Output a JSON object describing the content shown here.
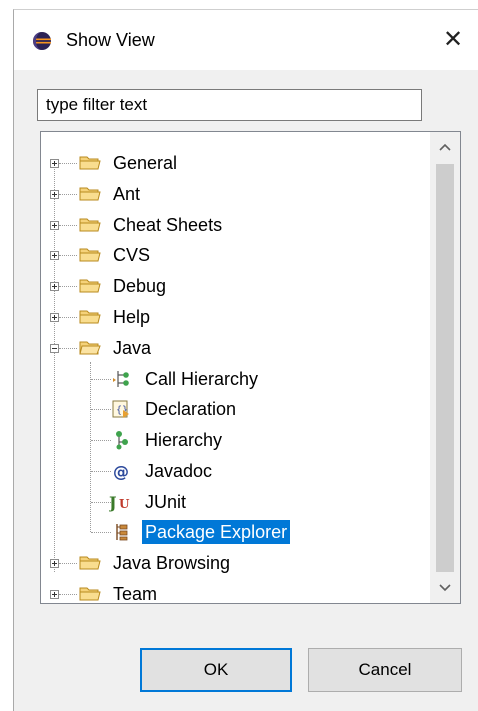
{
  "dialog": {
    "title": "Show View",
    "close_glyph": "✕"
  },
  "filter": {
    "value": "type filter text"
  },
  "tree": {
    "items": [
      {
        "label": "General",
        "icon": "folder-icon",
        "expanded": false
      },
      {
        "label": "Ant",
        "icon": "folder-icon",
        "expanded": false
      },
      {
        "label": "Cheat Sheets",
        "icon": "folder-icon",
        "expanded": false
      },
      {
        "label": "CVS",
        "icon": "folder-icon",
        "expanded": false
      },
      {
        "label": "Debug",
        "icon": "folder-icon",
        "expanded": false
      },
      {
        "label": "Help",
        "icon": "folder-icon",
        "expanded": false
      },
      {
        "label": "Java",
        "icon": "folder-icon",
        "expanded": true
      },
      {
        "label": "Java Browsing",
        "icon": "folder-icon",
        "expanded": false
      },
      {
        "label": "Team",
        "icon": "folder-icon",
        "expanded": false
      }
    ],
    "java_children": [
      {
        "label": "Call Hierarchy",
        "icon": "call-hierarchy-icon"
      },
      {
        "label": "Declaration",
        "icon": "declaration-icon"
      },
      {
        "label": "Hierarchy",
        "icon": "hierarchy-icon"
      },
      {
        "label": "Javadoc",
        "icon": "javadoc-icon"
      },
      {
        "label": "JUnit",
        "icon": "junit-icon"
      },
      {
        "label": "Package Explorer",
        "icon": "package-explorer-icon",
        "selected": true
      }
    ]
  },
  "buttons": {
    "ok": "OK",
    "cancel": "Cancel"
  },
  "colors": {
    "selection": "#0078d7",
    "folder": "#e8b84a"
  }
}
